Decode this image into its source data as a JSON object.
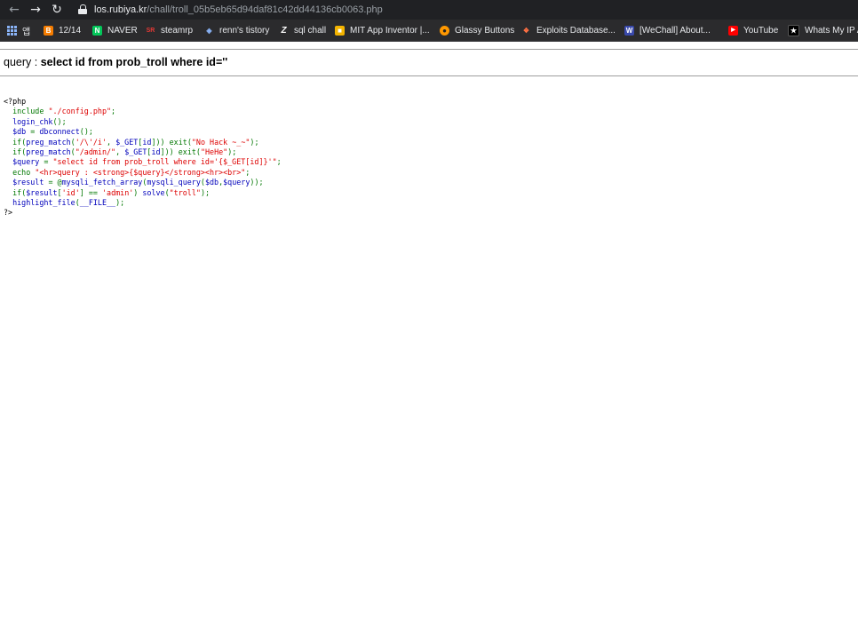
{
  "browser": {
    "url_host": "los.rubiya.kr",
    "url_path": "/chall/troll_05b5eb65d94daf81c42dd44136cb0063.php",
    "bookmarks": [
      {
        "label": "앱",
        "icon": "apps-grid-icon"
      },
      {
        "label": "12/14",
        "icon": "blogger-icon",
        "color": "#f57c00"
      },
      {
        "label": "NAVER",
        "icon": "naver-icon",
        "color": "#03c75a"
      },
      {
        "label": "steamrp",
        "icon": "steamrp-icon",
        "color": "#c62828"
      },
      {
        "label": "renn's tistory",
        "icon": "tistory-icon",
        "color": "#3d7bd9"
      },
      {
        "label": "sql chall",
        "icon": "z-icon",
        "color": "#ffffff"
      },
      {
        "label": "MIT App Inventor |...",
        "icon": "app-inventor-icon",
        "color": "#f4b400"
      },
      {
        "label": "Glassy Buttons",
        "icon": "glassy-buttons-icon",
        "color": "#ff9800"
      },
      {
        "label": "Exploits Database...",
        "icon": "exploit-db-icon",
        "color": "#e65100"
      },
      {
        "label": "[WeChall] About...",
        "icon": "wechall-icon",
        "color": "#3949ab"
      },
      {
        "label": "YouTube",
        "icon": "youtube-icon",
        "color": "#ff0000"
      },
      {
        "label": "Whats My IP A",
        "icon": "whatsmyip-icon",
        "color": "#000000"
      }
    ]
  },
  "page": {
    "query_prefix": "query : ",
    "query_value": "select id from prob_troll where id=''"
  },
  "code_lines": [
    "<?php",
    "  include \"./config.php\";",
    "  login_chk();",
    "  $db = dbconnect();",
    "  if(preg_match('/\\'/i', $_GET[id])) exit(\"No Hack ~_~\");",
    "  if(preg_match(\"/admin/\", $_GET[id])) exit(\"HeHe\");",
    "  $query = \"select id from prob_troll where id='{$_GET[id]}'\";",
    "  echo \"<hr>query : <strong>{$query}</strong><hr><br>\";",
    "  $result = @mysqli_fetch_array(mysqli_query($db,$query));",
    "  if($result['id'] == 'admin') solve(\"troll\");",
    "  highlight_file(__FILE__);",
    "?>"
  ],
  "colors": {
    "default": "#0000bb",
    "keyword": "#007700",
    "string": "#dd0000",
    "html": "#000000"
  }
}
